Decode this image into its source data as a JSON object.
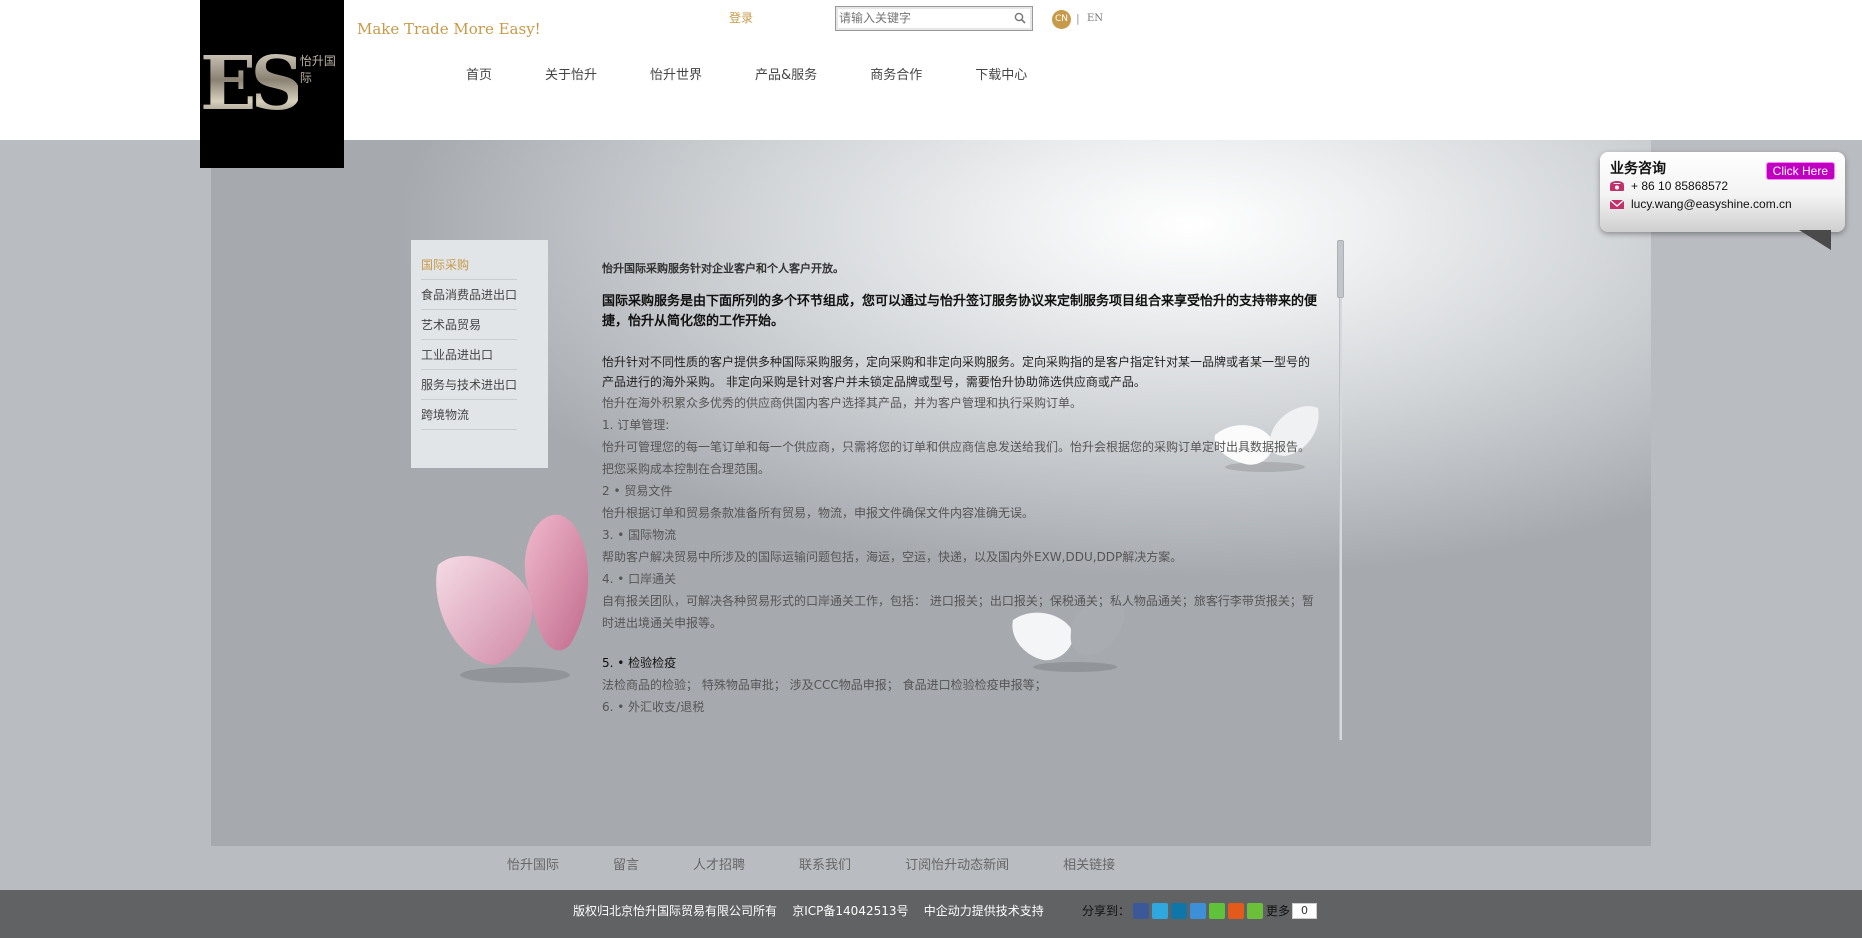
{
  "header": {
    "logo_text": "ES",
    "logo_cn": "怡升国际",
    "slogan": "Make Trade More Easy!",
    "login": "登录",
    "search_placeholder": "请输入关键字",
    "lang_cn": "CN",
    "lang_sep": "|",
    "lang_en": "EN",
    "nav": [
      "首页",
      "关于怡升",
      "怡升世界",
      "产品&服务",
      "商务合作",
      "下载中心"
    ]
  },
  "sidebar": {
    "items": [
      "国际采购",
      "食品消费品进出口",
      "艺术品贸易",
      "工业品进出口",
      "服务与技术进出口",
      "跨境物流"
    ]
  },
  "content": {
    "lead": "怡升国际采购服务针对企业客户和个人客户开放。",
    "big": "国际采购服务是由下面所列的多个环节组成，您可以通过与怡升签订服务协议来定制服务项目组合来享受怡升的支持带来的便捷，怡升从简化您的工作开始。",
    "p1": "怡升针对不同性质的客户提供多种国际采购服务，定向采购和非定向采购服务。定向采购指的是客户指定针对某一品牌或者某一型号的产品进行的海外采购。 非定向采购是针对客户并未锁定品牌或型号，需要怡升协助筛选供应商或产品。",
    "p2": "怡升在海外积累众多优秀的供应商供国内客户选择其产品，并为客户管理和执行采购订单。",
    "s1_title": "1.  订单管理:",
    "s1_body": "怡升可管理您的每一笔订单和每一个供应商，只需将您的订单和供应商信息发送给我们。怡升会根据您的采购订单定时出具数据报告。把您采购成本控制在合理范围。",
    "s2_title": "2 •  贸易文件",
    "s2_body": "怡升根据订单和贸易条款准备所有贸易，物流，申报文件确保文件内容准确无误。",
    "s3_title": "3. •  国际物流",
    "s3_body": "帮助客户解决贸易中所涉及的国际运输问题包括，海运，空运，快递，以及国内外EXW,DDU,DDP解决方案。",
    "s4_title": "4. •  口岸通关",
    "s4_body": "自有报关团队，可解决各种贸易形式的口岸通关工作，包括： 进口报关；出口报关；保税通关；私人物品通关；旅客行李带货报关；暂时进出境通关申报等。",
    "s5_title": "5. •  检验检疫",
    "s5_body": "法检商品的检验； 特殊物品审批； 涉及CCC物品申报； 食品进口检验检疫申报等；",
    "s6_title": "6. •  外汇收支/退税"
  },
  "consult": {
    "title": "业务咨询",
    "button": "Click Here",
    "phone": "+ 86 10 85868572",
    "email": "lucy.wang@easyshine.com.cn"
  },
  "footer": {
    "links": [
      "怡升国际",
      "留言",
      "人才招聘",
      "联系我们",
      "订阅怡升动态新闻",
      "相关链接"
    ],
    "copyright": "版权归北京怡升国际贸易有限公司所有    京ICP备14042513号    中企动力提供技术支持",
    "share_label": "分享到：",
    "more": "更多",
    "count": "0"
  },
  "colors": {
    "accent": "#c79a49",
    "footer_bg": "#606264",
    "consult_button": "#c000c0"
  }
}
